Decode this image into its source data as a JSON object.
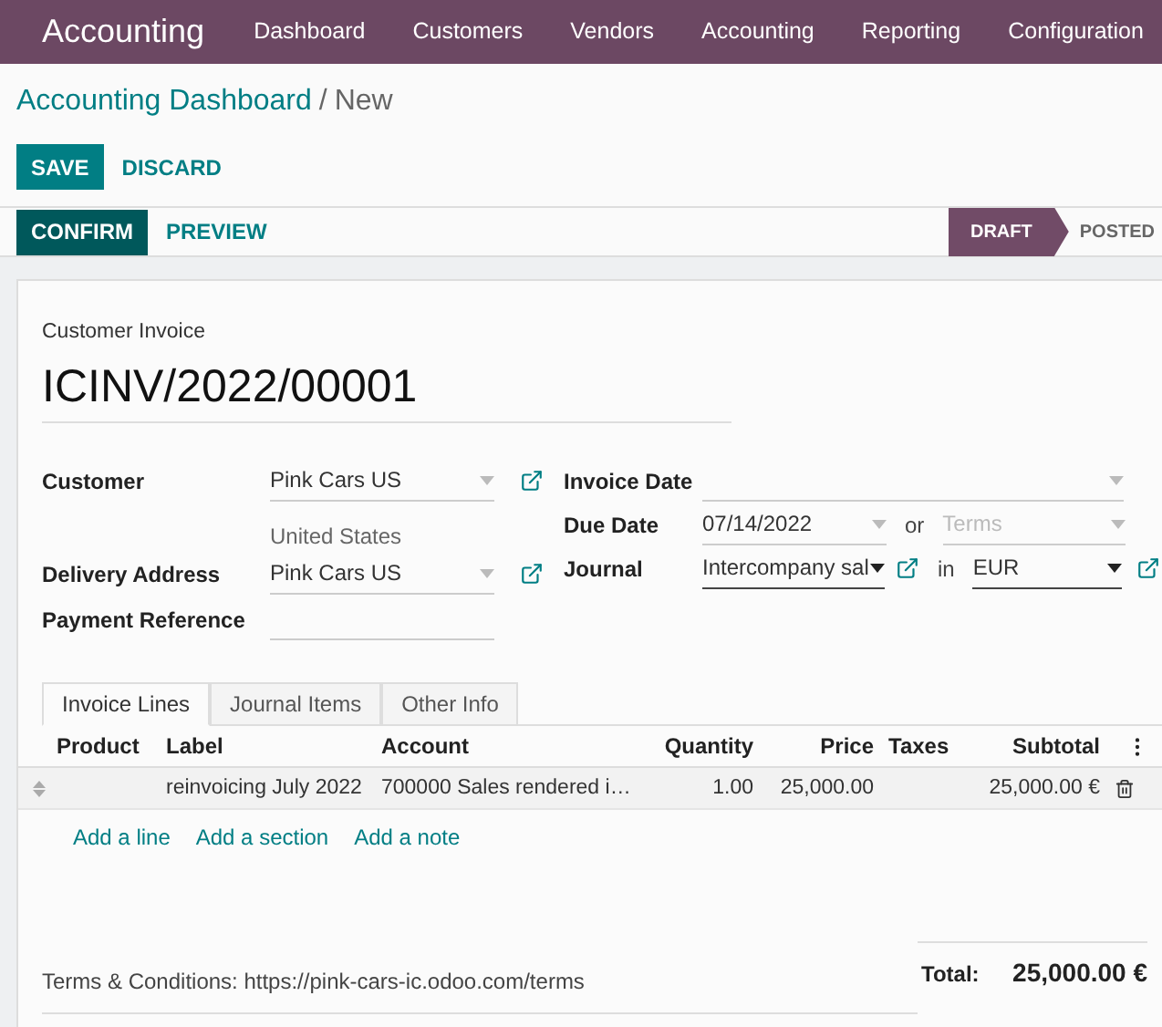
{
  "app": {
    "title": "Accounting"
  },
  "menu": [
    {
      "label": "Dashboard"
    },
    {
      "label": "Customers"
    },
    {
      "label": "Vendors"
    },
    {
      "label": "Accounting"
    },
    {
      "label": "Reporting"
    },
    {
      "label": "Configuration"
    }
  ],
  "breadcrumb": {
    "parent": "Accounting Dashboard",
    "separator": "/",
    "current": "New"
  },
  "buttons": [
    {
      "label": "SAVE",
      "kind": "primary"
    },
    {
      "label": "DISCARD",
      "kind": "link"
    }
  ],
  "actions": [
    {
      "label": "CONFIRM",
      "kind": "primary"
    },
    {
      "label": "PREVIEW",
      "kind": "link"
    }
  ],
  "status": [
    {
      "label": "DRAFT",
      "selected": true
    },
    {
      "label": "POSTED",
      "selected": false
    }
  ],
  "invoice": {
    "type": "Customer Invoice",
    "number": "ICINV/2022/00001"
  },
  "customer": {
    "label": "Customer",
    "value": "Pink Cars US",
    "address": "United States"
  },
  "delivery_address": {
    "label": "Delivery Address",
    "value": "Pink Cars US"
  },
  "payment_reference": {
    "label": "Payment Reference"
  },
  "invoice_date": {
    "label": "Invoice Date"
  },
  "due_date": {
    "label": "Due Date",
    "value": "07/14/2022",
    "separator": "or",
    "terms_placeholder": "Terms"
  },
  "journal": {
    "label": "Journal",
    "value": "Intercompany sal",
    "separator": "in",
    "currency": "EUR"
  },
  "tabs": [
    {
      "label": "Invoice Lines",
      "selected": true
    },
    {
      "label": "Journal Items",
      "selected": false
    },
    {
      "label": "Other Info",
      "selected": false
    }
  ],
  "table": {
    "columns": [
      {
        "label": "Product",
        "kind": "text"
      },
      {
        "label": "Label",
        "kind": "text"
      },
      {
        "label": "Account",
        "kind": "text"
      },
      {
        "label": "Quantity",
        "kind": "number"
      },
      {
        "label": "Price",
        "kind": "number"
      },
      {
        "label": "Taxes",
        "kind": "text"
      },
      {
        "label": "Subtotal",
        "kind": "number"
      }
    ],
    "rows": [
      {
        "cells": [
          "",
          "reinvoicing July 2022",
          "700000 Sales rendered i…",
          "1.00",
          "25,000.00",
          "",
          "25,000.00 €"
        ]
      }
    ]
  },
  "add_links": [
    {
      "label": "Add a line"
    },
    {
      "label": "Add a section"
    },
    {
      "label": "Add a note"
    }
  ],
  "terms": "Terms & Conditions: https://pink-cars-ic.odoo.com/terms",
  "total": {
    "label": "Total:",
    "value": "25,000.00 €"
  }
}
